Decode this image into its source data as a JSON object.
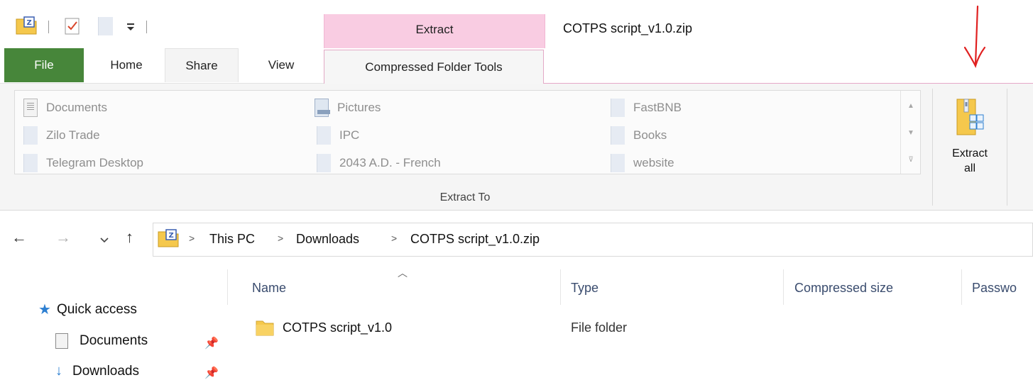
{
  "quick_access_toolbar": {
    "items": [
      "zip-folder-icon",
      "properties-icon",
      "new-folder-icon",
      "customize-dropdown-icon"
    ]
  },
  "context_tab_header": {
    "label": "Extract"
  },
  "window": {
    "title": "COTPS script_v1.0.zip"
  },
  "tabs": {
    "file": "File",
    "home": "Home",
    "share": "Share",
    "view": "View",
    "compressed_folder_tools": "Compressed Folder Tools"
  },
  "ribbon": {
    "extract_to": {
      "group_label": "Extract To",
      "destinations": [
        {
          "label": "Documents",
          "icon": "documents-icon"
        },
        {
          "label": "Zilo Trade",
          "icon": "folder-icon"
        },
        {
          "label": "Telegram Desktop",
          "icon": "folder-icon"
        },
        {
          "label": "Pictures",
          "icon": "pictures-icon"
        },
        {
          "label": "IPC",
          "icon": "folder-icon"
        },
        {
          "label": "2043 A.D. - French",
          "icon": "folder-icon"
        },
        {
          "label": "FastBNB",
          "icon": "folder-icon"
        },
        {
          "label": "Books",
          "icon": "folder-icon"
        },
        {
          "label": "website",
          "icon": "folder-icon"
        }
      ]
    },
    "extract_all": {
      "line1": "Extract",
      "line2": "all"
    }
  },
  "annotation": {
    "color": "#e02020",
    "icon": "red-arrow-down-icon"
  },
  "address_bar": {
    "crumbs": [
      "This PC",
      "Downloads",
      "COTPS script_v1.0.zip"
    ]
  },
  "nav_pane": {
    "quick_access": "Quick access",
    "items": [
      {
        "label": "Documents",
        "pinned": true
      },
      {
        "label": "Downloads",
        "pinned": true
      }
    ]
  },
  "file_list": {
    "columns": [
      "Name",
      "Type",
      "Compressed size",
      "Passwo"
    ],
    "rows": [
      {
        "name": "COTPS script_v1.0",
        "type": "File folder"
      }
    ]
  },
  "colors": {
    "file_tab": "#47863a",
    "context_tab": "#f9cce2",
    "folder_yellow": "#f5c84c",
    "accent_blue": "#2d7fd1"
  }
}
